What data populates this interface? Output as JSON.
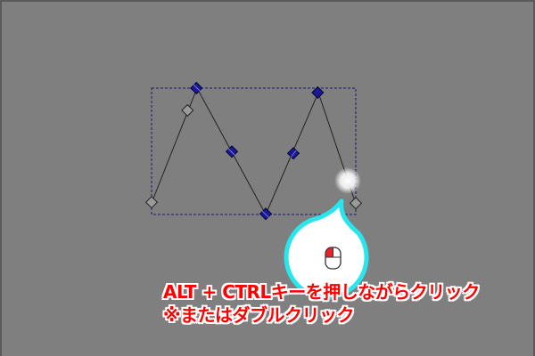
{
  "caption": {
    "line1": "ALT + CTRLキーを押しながらクリック",
    "line2": "※またはダブルクリック"
  },
  "colors": {
    "canvas_background": "#7f7f7f",
    "selection_box": "#1a1a6e",
    "path_stroke": "#222222",
    "selected_node": "#1a1a99",
    "unselected_node": "#9a9a9a",
    "callout_ring": "#29e5ec",
    "caption_text": "#ff0000"
  },
  "icons": {
    "callout": "mouse-left-click-icon",
    "cursor": "click-highlight-icon"
  }
}
